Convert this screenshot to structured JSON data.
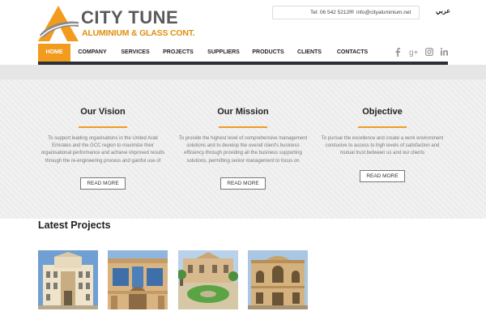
{
  "brand": {
    "name": "CITY TUNE",
    "tagline": "ALUMINIUM & GLASS CONT.",
    "accent": "#f29c1f",
    "dark": "#2b2f38"
  },
  "contact": {
    "tel": "Tel: 06 542 5212",
    "email": "info@cityaluminium.net",
    "mail_icon": "envelope-icon"
  },
  "lang_link": "عربي",
  "nav": {
    "items": [
      {
        "label": "HOME",
        "active": true
      },
      {
        "label": "COMPANY",
        "active": false
      },
      {
        "label": "SERVICES",
        "active": false
      },
      {
        "label": "PROJECTS",
        "active": false
      },
      {
        "label": "SUPPLIERS",
        "active": false
      },
      {
        "label": "PRODUCTS",
        "active": false
      },
      {
        "label": "CLIENTS",
        "active": false
      },
      {
        "label": "CONTACTS",
        "active": false
      }
    ],
    "social": [
      "facebook-icon",
      "google-plus-icon",
      "instagram-icon",
      "linkedin-icon"
    ]
  },
  "features": [
    {
      "title": "Our Vision",
      "text": "To support leading organisations in the United Arab Emirates and the GCC region to maximize their organisational performance and achieve improved results through the re-engineering process and gainful use of",
      "button": "READ MORE"
    },
    {
      "title": "Our Mission",
      "text": "To provide the highest level of comprehensive management solutions and to develop the overall client's business efficiency through providing all the business supporting solutions, permitting senior management to focus on",
      "button": "READ MORE"
    },
    {
      "title": "Objective",
      "text": "To pursue the excellence and create a work environment conducive to access  to high levels of satisfaction and mutual trust between us and our clients",
      "button": "READ MORE"
    }
  ],
  "latest_projects": {
    "title": "Latest Projects"
  }
}
